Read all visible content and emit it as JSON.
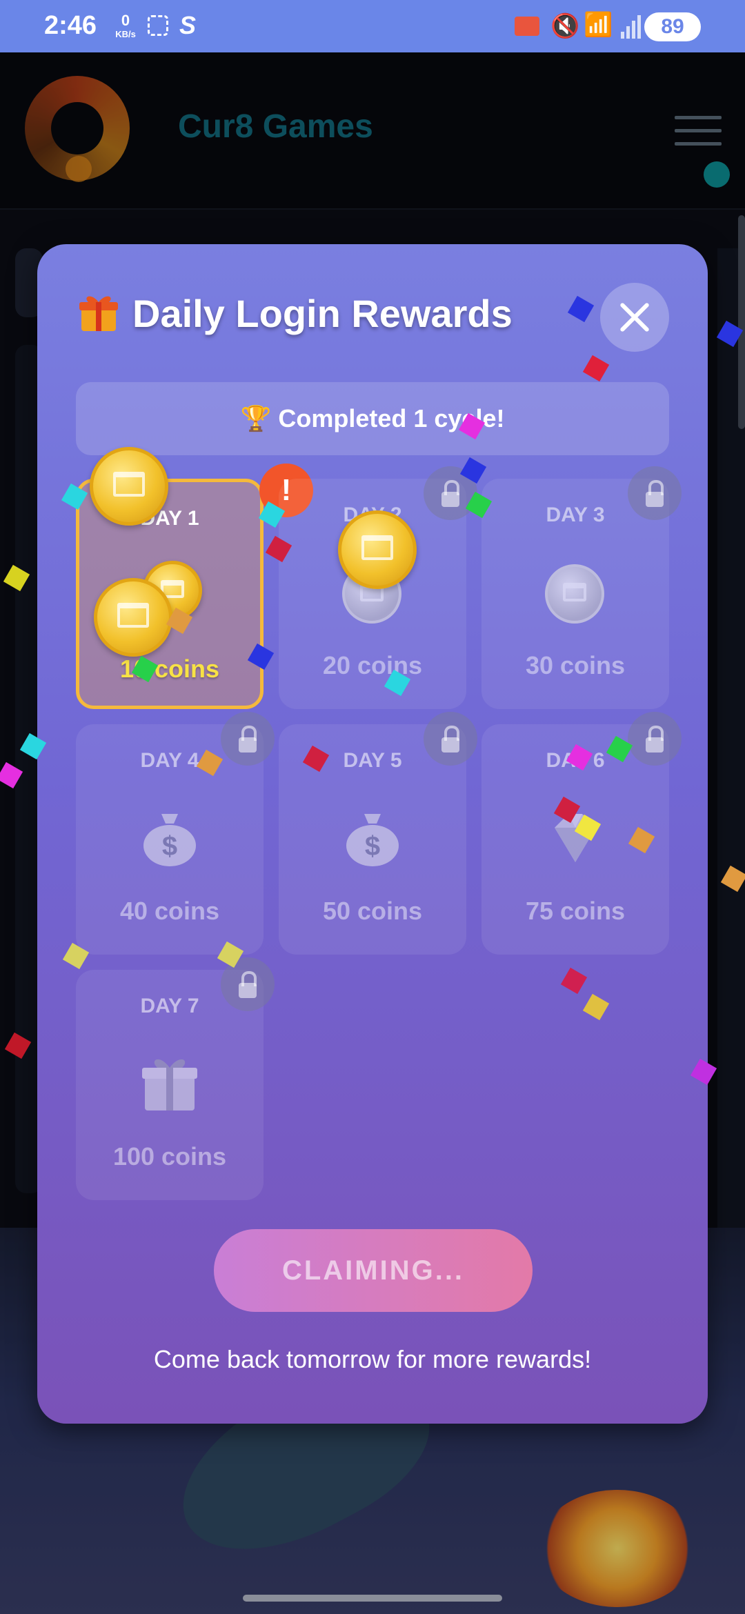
{
  "status_bar": {
    "time": "2:46",
    "net_speed_value": "0",
    "net_speed_unit": "KB/s",
    "battery": "89"
  },
  "app_header": {
    "title": "Cur8 Games"
  },
  "modal": {
    "title": "Daily Login Rewards",
    "title_icon": "gift-icon",
    "cycle_text": "Completed 1 cycle!",
    "cycle_icon": "trophy-icon",
    "days": [
      {
        "label": "DAY 1",
        "amount": "10 coins",
        "icon": "coin-icon",
        "state": "active"
      },
      {
        "label": "DAY 2",
        "amount": "20 coins",
        "icon": "coin-icon",
        "state": "locked"
      },
      {
        "label": "DAY 3",
        "amount": "30 coins",
        "icon": "coin-icon",
        "state": "locked"
      },
      {
        "label": "DAY 4",
        "amount": "40 coins",
        "icon": "money-bag-icon",
        "state": "locked"
      },
      {
        "label": "DAY 5",
        "amount": "50 coins",
        "icon": "money-bag-icon",
        "state": "locked"
      },
      {
        "label": "DAY 6",
        "amount": "75 coins",
        "icon": "gem-icon",
        "state": "locked"
      },
      {
        "label": "DAY 7",
        "amount": "100 coins",
        "icon": "gift-box-icon",
        "state": "locked"
      }
    ],
    "alert_mark": "!",
    "claim_button": "CLAIMING...",
    "footer": "Come back tomorrow for more rewards!"
  },
  "colors": {
    "status_bar": "#6a86e8",
    "accent_gold": "#f5b93c",
    "claim_gradient_start": "#c97ed6",
    "claim_gradient_end": "#e37aa8"
  }
}
